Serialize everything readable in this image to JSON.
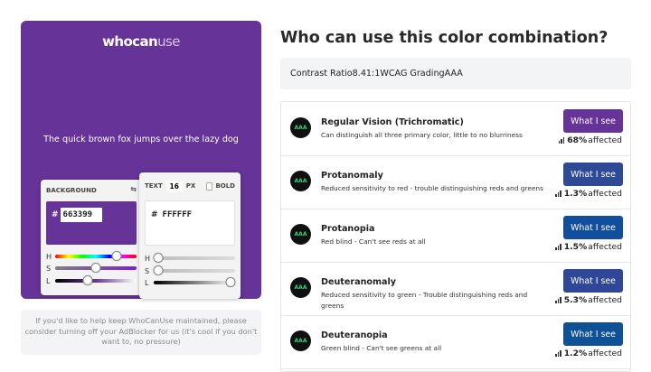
{
  "logo": {
    "bold": "whocan",
    "light": "use"
  },
  "preview": {
    "sample_text": "The quick brown fox jumps over the lazy dog",
    "background_color": "#663399",
    "text_color": "#FFFFFF"
  },
  "background_panel": {
    "label": "BACKGROUND",
    "swap_icon": "swap-icon",
    "hash": "#",
    "hex": "663399",
    "sliders": {
      "h_label": "H",
      "s_label": "S",
      "l_label": "L",
      "h": 0.75,
      "s": 0.5,
      "l": 0.4
    }
  },
  "text_panel": {
    "label": "TEXT",
    "size": "16",
    "unit": "PX",
    "bold_label": "BOLD",
    "bold_checked": false,
    "hash": "#",
    "hex": "FFFFFF",
    "sliders": {
      "h_label": "H",
      "s_label": "S",
      "l_label": "L",
      "h": 0.0,
      "s": 0.0,
      "l": 1.0
    }
  },
  "adblock_notice": "If you'd like to help keep WhoCanUse maintained, please consider turning off your AdBlocker for us (it's cool if you don't want to, no pressure)",
  "heading": "Who can use this color combination?",
  "contrast": {
    "text": "Contrast Ratio8.41:1WCAG GradingAAA"
  },
  "vision_types": [
    {
      "grade": "AAA",
      "name": "Regular Vision (Trichromatic)",
      "description": "Can distinguish all three primary color, little to no blurriness",
      "button": "What I see",
      "button_color": "#663399",
      "percent": "68%",
      "affected_label": "affected"
    },
    {
      "grade": "AAA",
      "name": "Protanomaly",
      "description": "Reduced sensitivity to red - trouble distinguishing reds and greens",
      "button": "What I see",
      "button_color": "#2e4a96",
      "percent": "1.3%",
      "affected_label": "affected"
    },
    {
      "grade": "AAA",
      "name": "Protanopia",
      "description": "Red blind - Can't see reds at all",
      "button": "What I see",
      "button_color": "#114e9e",
      "percent": "1.5%",
      "affected_label": "affected"
    },
    {
      "grade": "AAA",
      "name": "Deuteranomaly",
      "description": "Reduced sensitivity to green - Trouble distinguishing reds and greens",
      "button": "What I see",
      "button_color": "#2f4796",
      "percent": "5.3%",
      "affected_label": "affected"
    },
    {
      "grade": "AAA",
      "name": "Deuteranopia",
      "description": "Green blind - Can't see greens at all",
      "button": "What I see",
      "button_color": "#0f5196",
      "percent": "1.2%",
      "affected_label": "affected"
    }
  ]
}
